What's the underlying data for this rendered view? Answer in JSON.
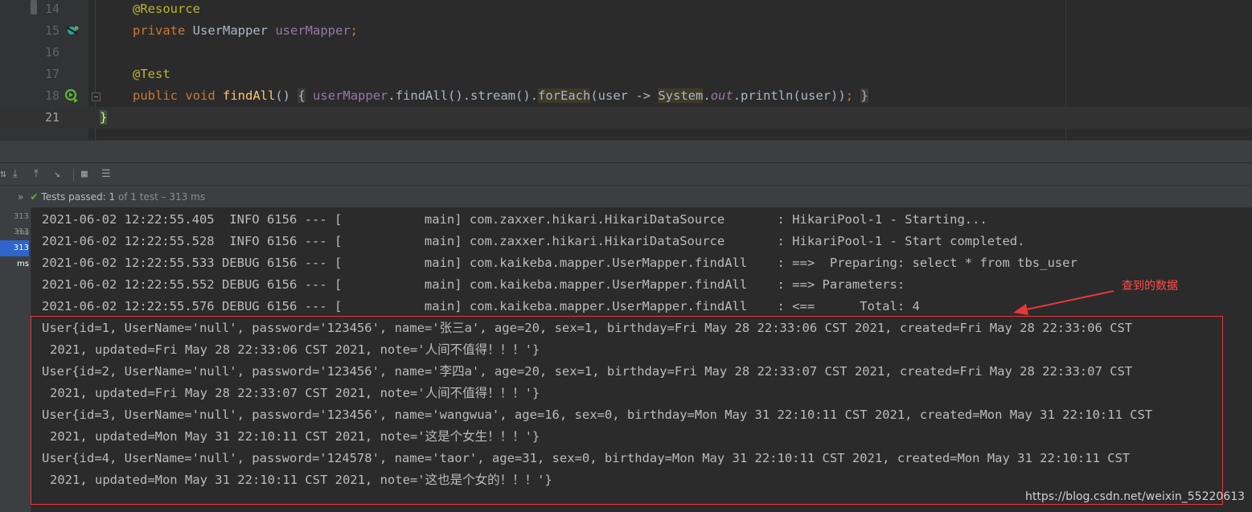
{
  "editor": {
    "line_numbers": [
      "14",
      "15",
      "16",
      "17",
      "18",
      "21"
    ],
    "line14": {
      "annotation": "@Resource"
    },
    "line15": {
      "kw": "private",
      "type": "UserMapper",
      "field": "userMapper",
      "semi": ";"
    },
    "line17": {
      "annotation": "@Test"
    },
    "line18": {
      "kw1": "public",
      "kw2": "void",
      "method": "findAll",
      "parens": "()",
      "open_brace": "{",
      "field": "userMapper",
      "call1": ".findAll().stream().",
      "foreach": "forEach",
      "lambda": "(user -> ",
      "system": "System",
      "dot": ".",
      "out": "out",
      "println": ".println(user)",
      "close_paren": ")",
      "semi": ";",
      "close_brace": "}"
    },
    "line21": {
      "brace": "}"
    }
  },
  "gutter_icons": {
    "line15": "injected-bean-icon",
    "line18": "run-test-icon"
  },
  "run_toolbar": {
    "icons": [
      "sort-icon",
      "import-tests-icon",
      "export-tests-icon",
      "filter-icon",
      "layout-icon",
      "settings-icon"
    ]
  },
  "status": {
    "chevron": "»",
    "label": "Tests passed:",
    "passed": "1",
    "detail": "of 1 test – 313 ms"
  },
  "test_tree": {
    "durations": [
      "313 ms",
      "313 ms",
      "313 ms"
    ],
    "selected_index": 2
  },
  "console": {
    "log_lines": [
      "2021-06-02 12:22:55.405  INFO 6156 --- [           main] com.zaxxer.hikari.HikariDataSource       : HikariPool-1 - Starting...",
      "2021-06-02 12:22:55.528  INFO 6156 --- [           main] com.zaxxer.hikari.HikariDataSource       : HikariPool-1 - Start completed.",
      "2021-06-02 12:22:55.533 DEBUG 6156 --- [           main] com.kaikeba.mapper.UserMapper.findAll    : ==>  Preparing: select * from tbs_user",
      "2021-06-02 12:22:55.552 DEBUG 6156 --- [           main] com.kaikeba.mapper.UserMapper.findAll    : ==> Parameters: ",
      "2021-06-02 12:22:55.576 DEBUG 6156 --- [           main] com.kaikeba.mapper.UserMapper.findAll    : <==      Total: 4"
    ],
    "users": [
      {
        "line1": "User{id=1, UserName='null', password='123456', name='张三a', age=20, sex=1, birthday=Fri May 28 22:33:06 CST 2021, created=Fri May 28 22:33:06 CST",
        "line2": "2021, updated=Fri May 28 22:33:06 CST 2021, note='人间不值得！！！'}"
      },
      {
        "line1": "User{id=2, UserName='null', password='123456', name='李四a', age=20, sex=1, birthday=Fri May 28 22:33:07 CST 2021, created=Fri May 28 22:33:07 CST",
        "line2": "2021, updated=Fri May 28 22:33:07 CST 2021, note='人间不值得！！！'}"
      },
      {
        "line1": "User{id=3, UserName='null', password='123456', name='wangwua', age=16, sex=0, birthday=Mon May 31 22:10:11 CST 2021, created=Mon May 31 22:10:11 CST",
        "line2": "2021, updated=Mon May 31 22:10:11 CST 2021, note='这是个女生！！！'}"
      },
      {
        "line1": "User{id=4, UserName='null', password='124578', name='taor', age=31, sex=0, birthday=Mon May 31 22:10:11 CST 2021, created=Mon May 31 22:10:11 CST",
        "line2": "2021, updated=Mon May 31 22:10:11 CST 2021, note='这也是个女的！！！'}"
      }
    ]
  },
  "annotation": {
    "text": "查到的数据",
    "color": "#ff4d4d"
  },
  "watermark": "https://blog.csdn.net/weixin_55220613",
  "colors": {
    "editor_bg": "#2b2b2b",
    "panel_bg": "#3c3f41",
    "keyword": "#cc7832",
    "annotation": "#bbb529",
    "field": "#9876aa",
    "method": "#ffc66d",
    "pass_green": "#5fb832",
    "selection": "#2f65ca",
    "highlight_box": "#e8373a"
  }
}
